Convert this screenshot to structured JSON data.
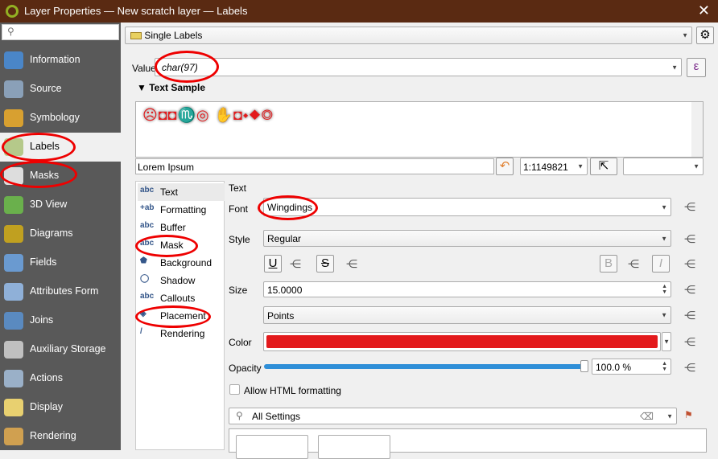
{
  "window": {
    "title": "Layer Properties — New scratch layer — Labels",
    "close": "✕"
  },
  "sidebar": {
    "search_placeholder": "",
    "items": [
      {
        "label": "Information",
        "icon": "info-icon",
        "color": "#4a86c8"
      },
      {
        "label": "Source",
        "icon": "source-icon",
        "color": "#8aa0b8"
      },
      {
        "label": "Symbology",
        "icon": "symbology-icon",
        "color": "#d8a030"
      },
      {
        "label": "Labels",
        "icon": "labels-icon",
        "color": "#b5c98a",
        "selected": true
      },
      {
        "label": "Masks",
        "icon": "masks-icon",
        "color": "#dddddd"
      },
      {
        "label": "3D View",
        "icon": "3d-view-icon",
        "color": "#6ab04c"
      },
      {
        "label": "Diagrams",
        "icon": "diagrams-icon",
        "color": "#c0a020"
      },
      {
        "label": "Fields",
        "icon": "fields-icon",
        "color": "#6a9ad0"
      },
      {
        "label": "Attributes Form",
        "icon": "attributes-form-icon",
        "color": "#8fb0d8"
      },
      {
        "label": "Joins",
        "icon": "joins-icon",
        "color": "#5a8ac0"
      },
      {
        "label": "Auxiliary Storage",
        "icon": "auxiliary-storage-icon",
        "color": "#c0c0c0"
      },
      {
        "label": "Actions",
        "icon": "actions-icon",
        "color": "#9ab0c8"
      },
      {
        "label": "Display",
        "icon": "display-icon",
        "color": "#e8d070"
      },
      {
        "label": "Rendering",
        "icon": "rendering-icon",
        "color": "#d0a050"
      }
    ]
  },
  "main": {
    "mode": "Single Labels",
    "value_label": "Value",
    "value": "char(97)",
    "expression_btn": "ε",
    "text_sample_header": "Text Sample",
    "sample_glyphs": "☹◘◘♏◎  ✋◘⬩◆◎",
    "sample_text": "Lorem Ipsum",
    "scale": "1:1149821",
    "tabs": [
      {
        "label": "Text",
        "icon": "abc"
      },
      {
        "label": "Formatting",
        "icon": "+ab"
      },
      {
        "label": "Buffer",
        "icon": "abc"
      },
      {
        "label": "Mask",
        "icon": "abc"
      },
      {
        "label": "Background",
        "icon": "⬟"
      },
      {
        "label": "Shadow",
        "icon": "◯"
      },
      {
        "label": "Callouts",
        "icon": "abc"
      },
      {
        "label": "Placement",
        "icon": "◈"
      },
      {
        "label": "Rendering",
        "icon": "/"
      }
    ],
    "section_title": "Text",
    "font_label": "Font",
    "font": "Wingdings",
    "style_label": "Style",
    "style": "Regular",
    "underline": "U",
    "strike": "S",
    "bold": "B",
    "italic": "I",
    "size_label": "Size",
    "size": "15.0000",
    "unit": "Points",
    "color_label": "Color",
    "color": "#e31a1c",
    "opacity_label": "Opacity",
    "opacity": "100.0 %",
    "opacity_value": 100,
    "html_label": "Allow HTML formatting",
    "html_checked": false,
    "settings_search": "All Settings"
  }
}
